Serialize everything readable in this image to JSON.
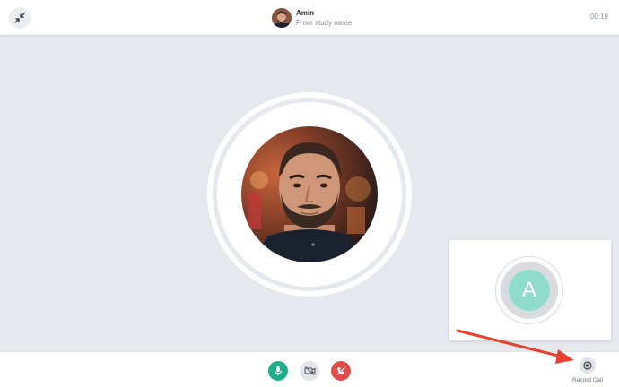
{
  "header": {
    "caller_name": "Amin",
    "caller_subtitle": "From study name",
    "timer": "00:19"
  },
  "self_preview": {
    "initial": "A",
    "avatar_color": "#8fdccb"
  },
  "controls": {
    "record_label": "Record Call"
  },
  "icons": {
    "minimize": "minimize-arrows-icon",
    "mic": "microphone-icon",
    "camera": "camera-off-icon",
    "hangup": "phone-hangup-icon",
    "record": "record-icon"
  },
  "colors": {
    "mic": "#1fae8b",
    "hangup": "#e04b4b",
    "annotation_arrow": "#e8402e"
  }
}
